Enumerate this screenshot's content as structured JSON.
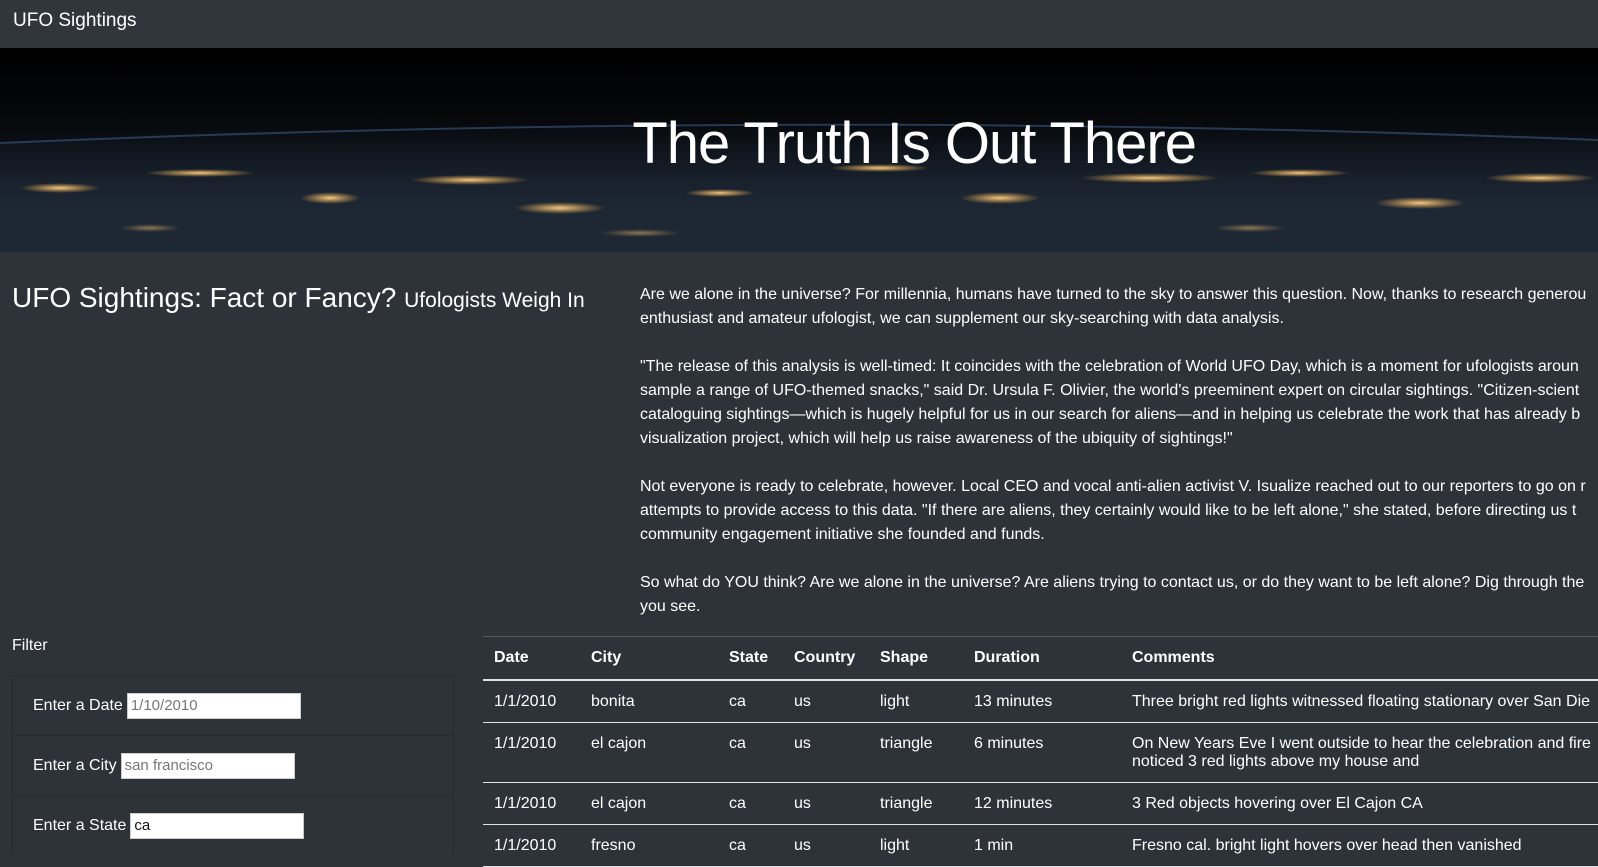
{
  "nav": {
    "brand": "UFO Sightings"
  },
  "hero": {
    "title": "The Truth Is Out There"
  },
  "headline": {
    "main": "UFO Sightings: Fact or Fancy?",
    "sub": "Ufologists Weigh In"
  },
  "article": {
    "paragraphs": [
      [
        "Are we alone in the universe? For millennia, humans have turned to the sky to answer this question. Now, thanks to research generou",
        "enthusiast and amateur ufologist, we can supplement our sky-searching with data analysis."
      ],
      [
        "\"The release of this analysis is well-timed: It coincides with the celebration of World UFO Day, which is a moment for ufologists aroun",
        "sample a range of UFO-themed snacks,\" said Dr. Ursula F. Olivier, the world's preeminent expert on circular sightings. \"Citizen-scient",
        "cataloguing sightings—which is hugely helpful for us in our search for aliens—and in helping us celebrate the work that has already b",
        "visualization project, which will help us raise awareness of the ubiquity of sightings!\""
      ],
      [
        "Not everyone is ready to celebrate, however. Local CEO and vocal anti-alien activist V. Isualize reached out to our reporters to go on r",
        "attempts to provide access to this data. \"If there are aliens, they certainly would like to be left alone,\" she stated, before directing us t",
        "community engagement initiative she founded and funds."
      ],
      [
        "So what do YOU think? Are we alone in the universe? Are aliens trying to contact us, or do they want to be left alone? Dig through the",
        "you see."
      ]
    ]
  },
  "filter": {
    "title": "Filter",
    "fields": [
      {
        "label": "Enter a Date",
        "placeholder": "1/10/2010",
        "value": ""
      },
      {
        "label": "Enter a City",
        "placeholder": "san francisco",
        "value": ""
      },
      {
        "label": "Enter a State",
        "placeholder": "",
        "value": "ca"
      }
    ]
  },
  "table": {
    "headers": [
      "Date",
      "City",
      "State",
      "Country",
      "Shape",
      "Duration",
      "Comments"
    ],
    "rows": [
      [
        "1/1/2010",
        "bonita",
        "ca",
        "us",
        "light",
        "13 minutes",
        "Three bright red lights witnessed floating stationary over San Die"
      ],
      [
        "1/1/2010",
        "el cajon",
        "ca",
        "us",
        "triangle",
        "6 minutes",
        "On New Years Eve I went outside to hear the celebration and fire\nnoticed 3 red lights above my house and"
      ],
      [
        "1/1/2010",
        "el cajon",
        "ca",
        "us",
        "triangle",
        "12 minutes",
        "3 Red objects hovering over El Cajon CA"
      ],
      [
        "1/1/2010",
        "fresno",
        "ca",
        "us",
        "light",
        "1 min",
        "Fresno cal. bright light hovers over head then vanished"
      ]
    ]
  }
}
